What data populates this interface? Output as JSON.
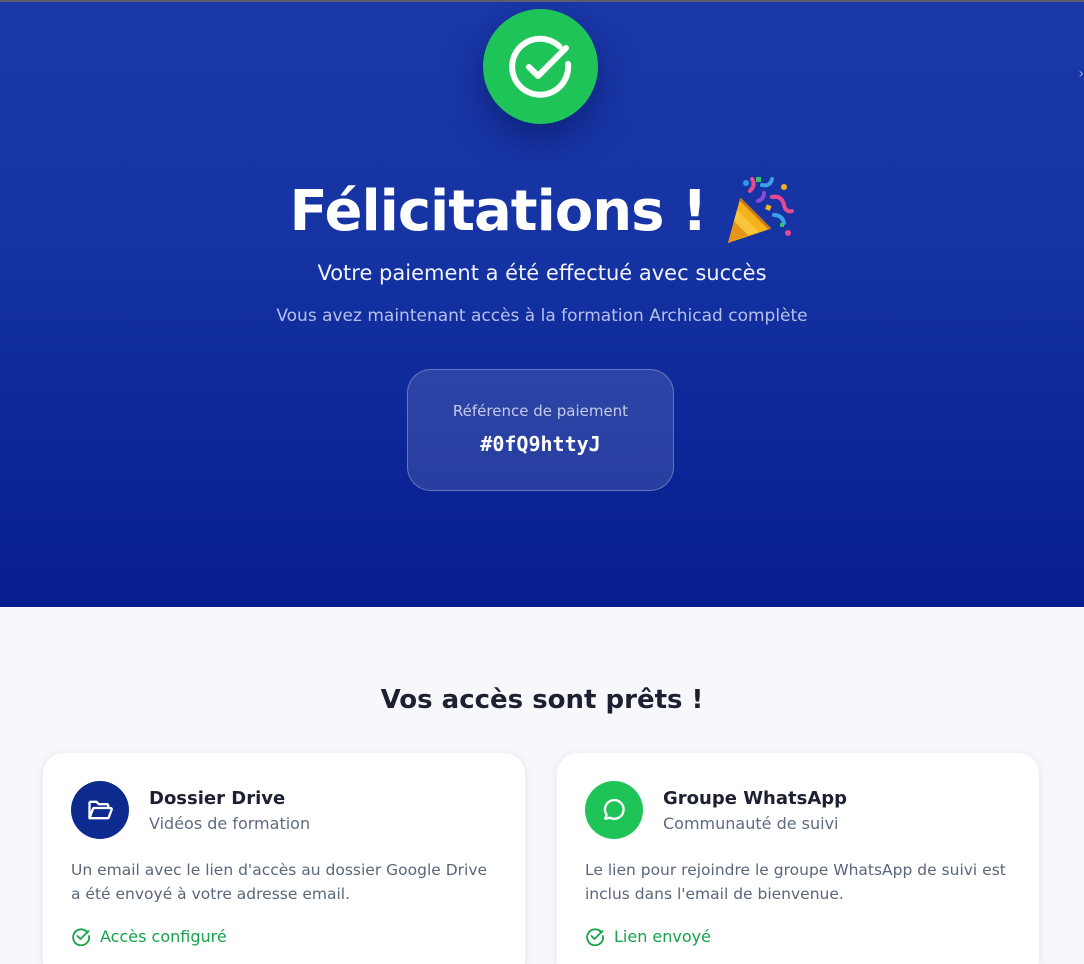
{
  "hero": {
    "title": "Félicitations !",
    "subtitle": "Votre paiement a été effectué avec succès",
    "description": "Vous avez maintenant accès à la formation Archicad complète",
    "reference_label": "Référence de paiement",
    "reference_code": "#0fQ9httyJ",
    "success_icon": "check-circle-icon",
    "celebration_icon": "party-popper-icon",
    "colors": {
      "primary": "#1533a3",
      "success": "#1fc458"
    }
  },
  "access": {
    "title": "Vos accès sont prêts !",
    "cards": [
      {
        "icon": "folder-icon",
        "title": "Dossier Drive",
        "subtitle": "Vidéos de formation",
        "text": "Un email avec le lien d'accès au dossier Google Drive a été envoyé à votre adresse email.",
        "status": "Accès configuré"
      },
      {
        "icon": "chat-bubble-icon",
        "title": "Groupe WhatsApp",
        "subtitle": "Communauté de suivi",
        "text": "Le lien pour rejoindre le groupe WhatsApp de suivi est inclus dans l'email de bienvenue.",
        "status": "Lien envoyé"
      }
    ]
  }
}
